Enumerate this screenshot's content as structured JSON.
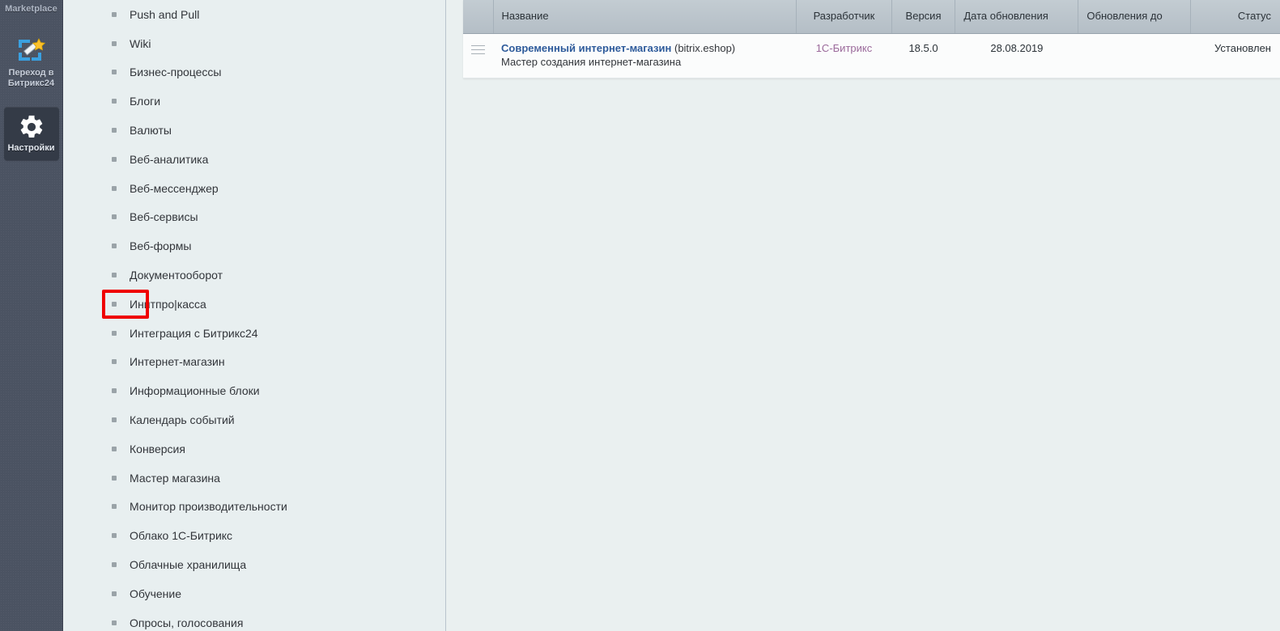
{
  "rail": {
    "title": "Marketplace",
    "buttons": [
      {
        "id": "bitrix24",
        "label": "Переход в\nБитрикс24",
        "label_line1": "Переход в",
        "label_line2": "Битрикс24",
        "icon": "magic-wand-frame-icon"
      },
      {
        "id": "settings",
        "label": "Настройки",
        "icon": "gear-icon"
      }
    ]
  },
  "menu": {
    "items": [
      {
        "label": "Push and Pull"
      },
      {
        "label": "Wiki"
      },
      {
        "label": "Бизнес-процессы"
      },
      {
        "label": "Блоги"
      },
      {
        "label": "Валюты"
      },
      {
        "label": "Веб-аналитика"
      },
      {
        "label": "Веб-мессенджер"
      },
      {
        "label": "Веб-сервисы"
      },
      {
        "label": "Веб-формы"
      },
      {
        "label": "Документооборот"
      },
      {
        "label": "Инитпро|касса"
      },
      {
        "label": "Интеграция с Битрикс24"
      },
      {
        "label": "Интернет-магазин"
      },
      {
        "label": "Информационные блоки"
      },
      {
        "label": "Календарь событий"
      },
      {
        "label": "Конверсия"
      },
      {
        "label": "Мастер магазина"
      },
      {
        "label": "Монитор производительности"
      },
      {
        "label": "Облако 1С-Битрикс"
      },
      {
        "label": "Облачные хранилища"
      },
      {
        "label": "Обучение"
      },
      {
        "label": "Опросы, голосования"
      }
    ],
    "highlighted_index": 10,
    "highlight_color": "#ef0000"
  },
  "table": {
    "columns": [
      {
        "key": "grip",
        "label": ""
      },
      {
        "key": "name",
        "label": "Название"
      },
      {
        "key": "developer",
        "label": "Разработчик"
      },
      {
        "key": "version",
        "label": "Версия"
      },
      {
        "key": "update_date",
        "label": "Дата обновления"
      },
      {
        "key": "updates_until",
        "label": "Обновления до"
      },
      {
        "key": "status",
        "label": "Статус"
      }
    ],
    "rows": [
      {
        "grip": "drag-handle-icon",
        "name_title": "Современный интернет-магазин",
        "name_code": "(bitrix.eshop)",
        "name_desc": "Мастер создания интернет-магазина",
        "developer": "1С-Битрикс",
        "version": "18.5.0",
        "update_date": "28.08.2019",
        "updates_until": "",
        "status": "Установлен"
      }
    ]
  },
  "colors": {
    "rail_bg": "#4b5362",
    "menu_bg": "#e8eff0",
    "content_bg": "#eaf0f0",
    "header_bg": "#b9c3ca",
    "link": "#2e5b9b",
    "dev_link": "#9b6a9b",
    "highlight": "#ef0000"
  }
}
